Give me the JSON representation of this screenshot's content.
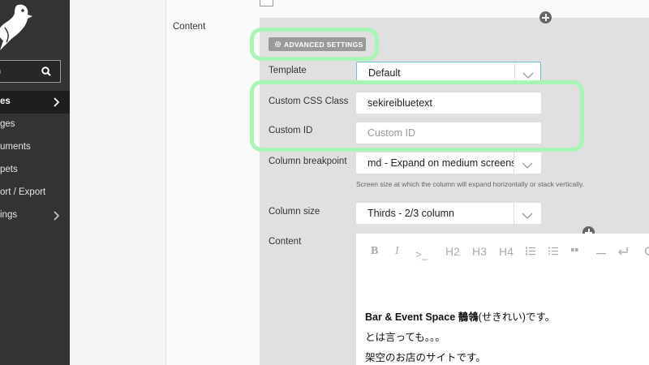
{
  "sidebar": {
    "search_text": "h",
    "items": [
      {
        "label": "es",
        "active": true
      },
      {
        "label": "ges"
      },
      {
        "label": "uments"
      },
      {
        "label": "pets"
      },
      {
        "label": "ort / Export"
      },
      {
        "label": "ings"
      }
    ]
  },
  "block": {
    "content_label": "Content",
    "advanced_label": "ADVANCED SETTINGS"
  },
  "fields": {
    "template": {
      "label": "Template",
      "value": "Default"
    },
    "css_class": {
      "label": "Custom CSS Class",
      "value": "sekireibluetext"
    },
    "custom_id": {
      "label": "Custom ID",
      "placeholder": "Custom ID"
    },
    "breakpoint": {
      "label": "Column breakpoint",
      "value": "md - Expand on medium screens",
      "help": "Screen size at which the column will expand horizontally or stack vertically."
    },
    "column_size": {
      "label": "Column size",
      "value": "Thirds - 2/3 column"
    },
    "content": {
      "label": "Content"
    }
  },
  "editor": {
    "toolbar": {
      "bold": "B",
      "italic": "I",
      "code": ">_",
      "h2": "H2",
      "h3": "H3",
      "h4": "H4"
    },
    "paragraphs": {
      "p1_bold": "Bar & Event Space 鶺鴒",
      "p1_rest": "(せきれい)です。",
      "p2": "とは言っても。。。",
      "p3": "架空のお店のサイトです。"
    }
  },
  "colors": {
    "sidebar_bg": "#333333",
    "panel_bg": "#e0e0e0",
    "highlight": "#a9f5b5",
    "focus_border": "#6ec1ce"
  }
}
